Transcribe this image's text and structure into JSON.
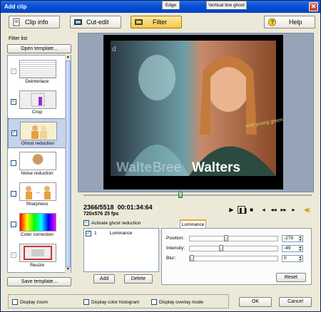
{
  "window": {
    "title": "Add clip"
  },
  "toolbar": {
    "clip_info": "Clip info",
    "cut_edit": "Cut-edit",
    "filter": "Filter",
    "help": "Help"
  },
  "sidebar": {
    "label": "Filter list",
    "open_template": "Open template...",
    "save_template": "Save template...",
    "filters": [
      {
        "label": "Deinterlace",
        "checked": true,
        "enabled": false
      },
      {
        "label": "Crop",
        "checked": true,
        "enabled": true
      },
      {
        "label": "Ghost reduction",
        "checked": true,
        "enabled": true,
        "selected": true
      },
      {
        "label": "Noise reduction",
        "checked": false,
        "enabled": true
      },
      {
        "label": "Sharpness",
        "checked": false,
        "enabled": true
      },
      {
        "label": "Color correction",
        "checked": false,
        "enabled": true
      },
      {
        "label": "Resize",
        "checked": true,
        "enabled": false
      }
    ]
  },
  "video": {
    "caption_left_a": "Walte",
    "caption_left_b": "Bree",
    "caption_right": "Walters",
    "shirt_text": "wild young greens"
  },
  "status": {
    "frame": "2366/5518",
    "timecode": "00:01:34:64",
    "format": "720x576 25 fps"
  },
  "ghost": {
    "activate_label": "Activate ghost reduction",
    "activate_checked": true,
    "list_item_index": "1",
    "list_item_name": "Luminance",
    "add_label": "Add",
    "delete_label": "Delete"
  },
  "tabs": [
    "Edge",
    "Luminance",
    "Vertical line ghost"
  ],
  "params": {
    "position_label": "Position:",
    "position_value": "-278",
    "intensity_label": "Intensity:",
    "intensity_value": "-49",
    "blur_label": "Blur:",
    "blur_value": "0",
    "reset_label": "Reset"
  },
  "bottom": {
    "display_zoom": "Display zoom",
    "display_histogram": "Display color histogram",
    "display_overlay": "Display overlay mode",
    "ok": "OK",
    "cancel": "Cancel"
  }
}
